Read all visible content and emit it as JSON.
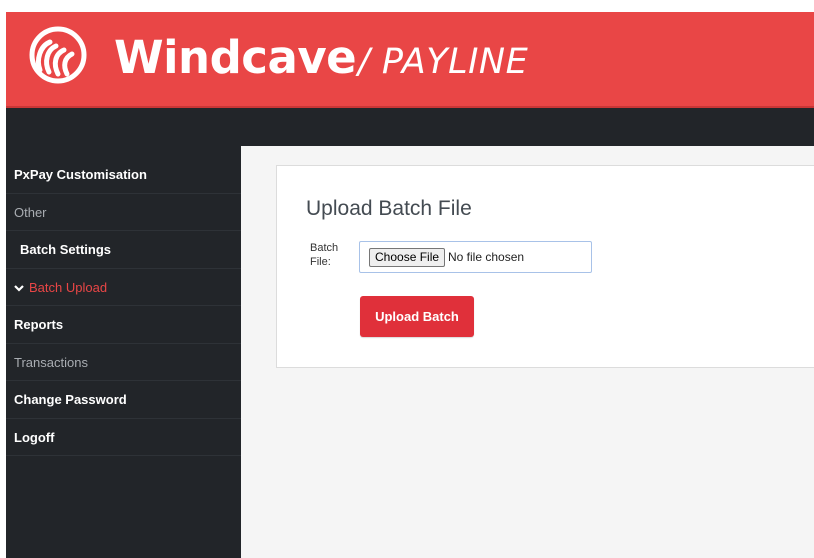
{
  "brand": {
    "name": "Windcave",
    "product": "/ PAYLINE",
    "logo_icon": "windcave-logo-icon",
    "color": "#e94646"
  },
  "sidebar": {
    "items": [
      {
        "label": "PxPay Customisation",
        "style": "bold"
      },
      {
        "label": "Other",
        "style": "muted"
      },
      {
        "label": "Batch Settings",
        "style": "sub"
      },
      {
        "label": "Batch Upload",
        "style": "active",
        "icon": "chevron-down-icon"
      },
      {
        "label": "Reports",
        "style": "bold"
      },
      {
        "label": "Transactions",
        "style": "muted"
      },
      {
        "label": "Change Password",
        "style": "bold"
      },
      {
        "label": "Logoff",
        "style": "bold"
      }
    ]
  },
  "main": {
    "title": "Upload Batch File",
    "field_label": "Batch File:",
    "choose_label": "Choose File",
    "file_status": "No file chosen",
    "upload_label": "Upload Batch",
    "upload_color": "#e0303a"
  }
}
